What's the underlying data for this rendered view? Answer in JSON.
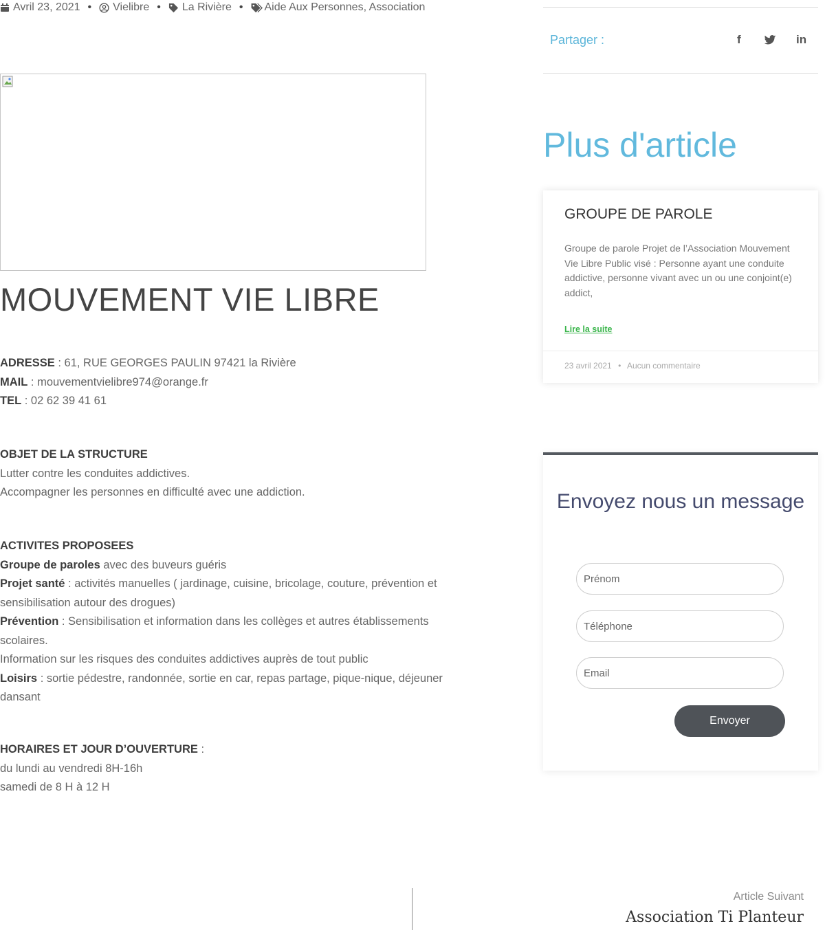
{
  "meta": {
    "date": "Avril 23, 2021",
    "author": "Vielibre",
    "location": "La Rivière",
    "categories": "Aide Aux Personnes, Association"
  },
  "post": {
    "title": "MOUVEMENT VIE LIBRE",
    "address_label": "ADRESSE",
    "address_value": " : 61, RUE GEORGES PAULIN 97421 la Rivière",
    "mail_label": "MAIL",
    "mail_value": " : mouvementvielibre974@orange.fr",
    "tel_label": "TEL",
    "tel_value": " : 02 62 39 41 61",
    "objet_heading": "OBJET DE LA STRUCTURE",
    "objet_line1": "Lutter contre les conduites addictives.",
    "objet_line2": "Accompagner les personnes en difficulté avec une addiction.",
    "activites_heading": "ACTIVITES PROPOSEES",
    "act1_label": "Groupe de paroles",
    "act1_text": " avec des buveurs guéris",
    "act2_label": "Projet santé",
    "act2_text": " : activités manuelles ( jardinage, cuisine, bricolage, couture, prévention et",
    "act2_text_cont": "sensibilisation autour des drogues)",
    "act3_label": "Prévention",
    "act3_text": " : Sensibilisation et information dans les collèges et autres établissements",
    "act3_text_cont": "scolaires.",
    "act4_text": "Information sur les risques des conduites addictives auprès de tout public",
    "act5_label": "Loisirs",
    "act5_text": " : sortie pédestre, randonnée, sortie en car, repas partage, pique-nique, déjeuner",
    "act5_text_cont": "dansant",
    "horaires_heading": "HORAIRES ET JOUR D’OUVERTURE",
    "horaires_colon": " :",
    "horaires_line1": "du lundi au vendredi 8H-16h",
    "horaires_line2": "samedi de 8 H à 12 H"
  },
  "share": {
    "label": "Partager :",
    "facebook": "f",
    "twitter": "twitter-bird",
    "linkedin": "in"
  },
  "more": {
    "title": "Plus d'article",
    "card": {
      "title": "GROUPE DE PAROLE",
      "excerpt": "Groupe de parole Projet de l’Association Mouvement Vie Libre Public visé : Personne ayant une conduite addictive, personne vivant avec un ou une conjoint(e) addict,",
      "read_more": "Lire la suite",
      "date": "23 avril 2021",
      "separator": "•",
      "comments": "Aucun commentaire"
    }
  },
  "contact": {
    "title": "Envoyez nous un message",
    "firstname_placeholder": "Prénom",
    "phone_placeholder": "Téléphone",
    "email_placeholder": "Email",
    "submit": "Envoyer"
  },
  "nav": {
    "next_label": "Article Suivant",
    "next_title": "Association Ti Planteur"
  },
  "icons": {
    "date": "calendar-icon",
    "author": "user-circle-icon",
    "location": "tag-icon",
    "categories": "tags-icon"
  },
  "colors": {
    "accent_blue": "#61b9dd",
    "link_green": "#39b54a",
    "button_dark": "#4f5358",
    "form_title": "#444a6d"
  }
}
